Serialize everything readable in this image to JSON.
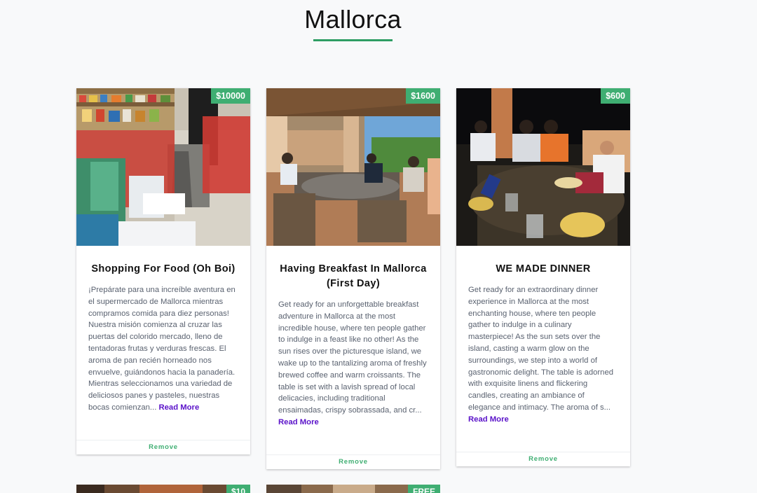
{
  "page": {
    "title": "Mallorca",
    "accent": "#2e9e63"
  },
  "cards": [
    {
      "price": "$10000",
      "title": "Shopping For Food (Oh Boi)",
      "excerpt": "¡Prepárate para una increíble aventura en el supermercado de Mallorca mientras compramos comida para diez personas! Nuestra misión comienza al cruzar las puertas del colorido mercado, lleno de tentadoras frutas y verduras frescas. El aroma de pan recién horneado nos envuelve, guiándonos hacia la panadería. Mientras seleccionamos una variedad de deliciosos panes y pasteles, nuestras bocas comienzan...",
      "read_more": "Read More",
      "remove": "Remove"
    },
    {
      "price": "$1600",
      "title": "Having Breakfast In Mallorca (First Day)",
      "excerpt": "Get ready for an unforgettable breakfast adventure in Mallorca at the most incredible house, where ten people gather to indulge in a feast like no other! As the sun rises over the picturesque island, we wake up to the tantalizing aroma of freshly brewed coffee and warm croissants. The table is set with a lavish spread of local delicacies, including traditional ensaimadas, crispy sobrassada, and cr...",
      "read_more": "Read More",
      "remove": "Remove"
    },
    {
      "price": "$600",
      "title": "WE MADE DINNER",
      "excerpt": "Get ready for an extraordinary dinner experience in Mallorca at the most enchanting house, where ten people gather to indulge in a culinary masterpiece! As the sun sets over the island, casting a warm glow on the surroundings, we step into a world of gastronomic delight. The table is adorned with exquisite linens and flickering candles, creating an ambiance of elegance and intimacy. The aroma of s...",
      "read_more": "Read More",
      "remove": "Remove"
    }
  ],
  "partial_cards": [
    {
      "price": "$10"
    },
    {
      "price": "FREE"
    }
  ]
}
